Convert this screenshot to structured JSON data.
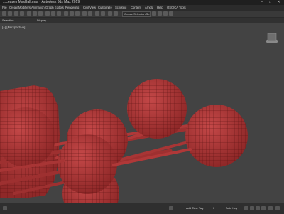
{
  "window": {
    "title": "...Leaves MaxBall.max - Autodesk 3ds Max 2019",
    "minimize": "–",
    "maximize": "□",
    "close": "✕"
  },
  "menu": [
    "File",
    "Create",
    "Modifiers",
    "Animation",
    "Graph Editors",
    "Rendering",
    "Civil View",
    "Customize",
    "Scripting",
    "Content",
    "Arnold",
    "Help",
    "OSCICA Tools"
  ],
  "toolbar": {
    "selection_set": "Create Selection Set"
  },
  "ribbon": {
    "tabs": [
      "Selection",
      "Display"
    ]
  },
  "viewport": {
    "label": "[+] [Perspective]"
  },
  "status": {
    "add_time_tag": "Add Time Tag",
    "frame_text": "0",
    "auto_key": "Auto Key"
  },
  "colors": {
    "sphere_fill": "#b53a3a",
    "wire": "#5a1212",
    "viewport_bg": "#434343"
  }
}
